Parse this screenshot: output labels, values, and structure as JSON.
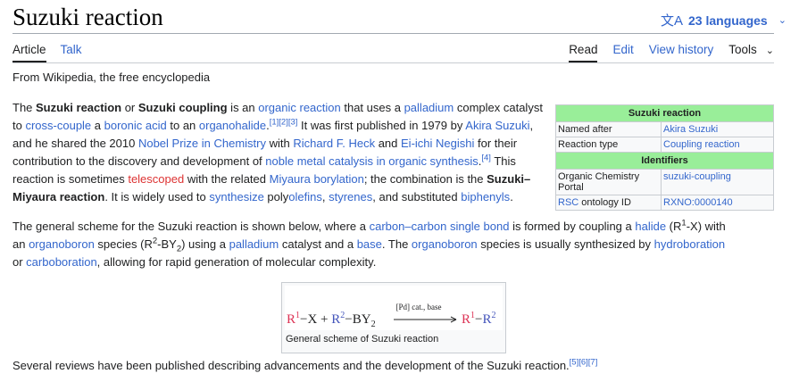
{
  "header": {
    "title": "Suzuki reaction",
    "languages_label": "23 languages"
  },
  "tabs_left": [
    "Article",
    "Talk"
  ],
  "tabs_right": [
    "Read",
    "Edit",
    "View history",
    "Tools"
  ],
  "tagline": "From Wikipedia, the free encyclopedia",
  "infobox": {
    "title": "Suzuki reaction",
    "rows1": [
      {
        "label": "Named after",
        "value": "Akira Suzuki"
      },
      {
        "label": "Reaction type",
        "value": "Coupling reaction"
      }
    ],
    "section": "Identifiers",
    "rows2": [
      {
        "label": "Organic Chemistry Portal",
        "value": "suzuki-coupling"
      },
      {
        "label_link": "RSC",
        "label_rest": " ontology ID",
        "value": "RXNO:0000140"
      }
    ]
  },
  "figure": {
    "caption": "General scheme of Suzuki reaction",
    "condition": "[Pd] cat., base",
    "colors": {
      "r1": "#dd3355",
      "r2": "#4455bb",
      "text": "#202122"
    }
  },
  "p1": {
    "t1": "The ",
    "b1": "Suzuki reaction",
    "t2": " or ",
    "b2": "Suzuki coupling",
    "t3": " is an ",
    "l1": "organic reaction",
    "t4": " that uses a ",
    "l2": "palladium",
    "t5": " complex catalyst to ",
    "l3": "cross-couple",
    "t6": " a ",
    "l4": "boronic acid",
    "t7": " to an ",
    "l5": "organohalide",
    "t8": ".",
    "s1": "[1][2][3]",
    "t9": " It was first published in 1979 by ",
    "l6": "Akira Suzuki",
    "t10": ", and he shared the 2010 ",
    "l7": "Nobel Prize in Chemistry",
    "t11": " with ",
    "l8": "Richard F. Heck",
    "t12": " and ",
    "l9": "Ei-ichi Negishi",
    "t13": " for their contribution to the discovery and development of ",
    "l10": "noble metal catalysis in organic synthesis",
    "t14": ".",
    "s2": "[4]",
    "t15": " This reaction is sometimes ",
    "r1": "telescoped",
    "t16": " with the related ",
    "l11": "Miyaura borylation",
    "t17": "; the combination is the ",
    "b3": "Suzuki–Miyaura reaction",
    "t18": ". It is widely used to ",
    "l12": "synthesize",
    "t19": " poly",
    "l13": "olefins",
    "t20": ", ",
    "l14": "styrenes",
    "t21": ", and substituted ",
    "l15": "biphenyls",
    "t22": "."
  },
  "p2": {
    "t1": "The general scheme for the Suzuki reaction is shown below, where a ",
    "l1": "carbon–carbon single bond",
    "t2": " is formed by coupling a ",
    "l2": "halide",
    "t3": " (R",
    "s1": "1",
    "t4": "-X) with an ",
    "l3": "organoboron",
    "t5": " species (R",
    "s2": "2",
    "t6": "-BY",
    "sub1": "2",
    "t7": ") using a ",
    "l4": "palladium",
    "t8": " catalyst and a ",
    "l5": "base",
    "t9": ". The ",
    "l6": "organoboron",
    "t10": " species is usually synthesized by ",
    "l7": "hydroboration",
    "t11": " or ",
    "l8": "carboboration",
    "t12": ", allowing for rapid generation of molecular complexity."
  },
  "p3": {
    "t1": "Several reviews have been published describing advancements and the development of the Suzuki reaction.",
    "s1": "[5][6][7]"
  }
}
